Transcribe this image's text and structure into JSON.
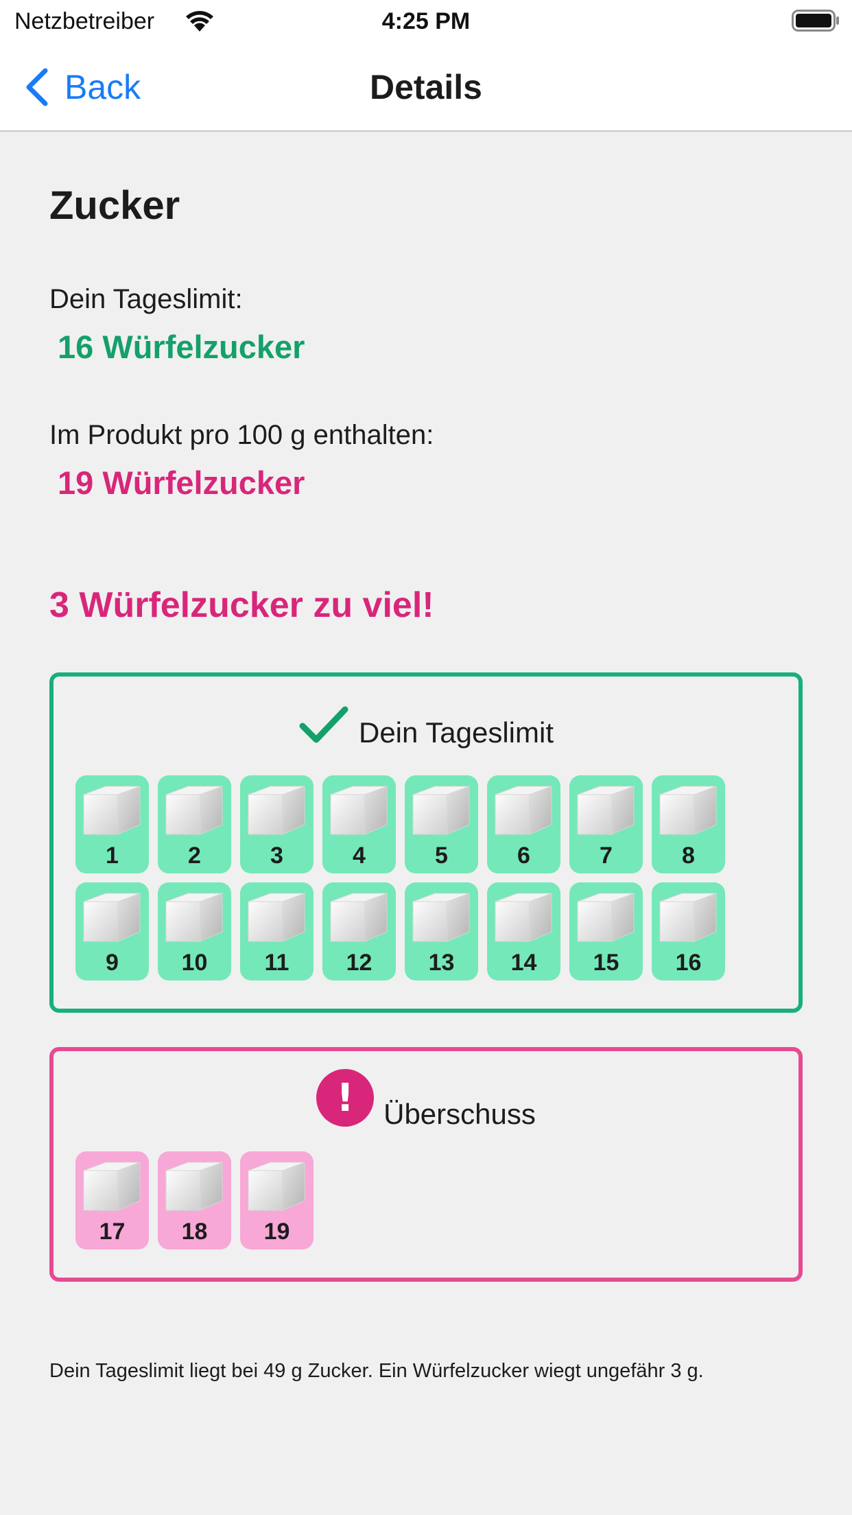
{
  "status_bar": {
    "carrier": "Netzbetreiber",
    "time": "4:25 PM"
  },
  "nav": {
    "back_label": "Back",
    "title": "Details"
  },
  "detail": {
    "title": "Zucker",
    "limit_label": "Dein Tageslimit:",
    "limit_value": "16 Würfelzucker",
    "product_label": "Im Produkt pro 100 g enthalten:",
    "product_value": "19 Würfelzucker",
    "warning": "3 Würfelzucker zu viel!"
  },
  "limit_box": {
    "icon": "checkmark-icon",
    "label": "Dein Tageslimit",
    "cubes": [
      "1",
      "2",
      "3",
      "4",
      "5",
      "6",
      "7",
      "8",
      "9",
      "10",
      "11",
      "12",
      "13",
      "14",
      "15",
      "16"
    ]
  },
  "excess_box": {
    "icon": "exclamation-icon",
    "icon_glyph": "!",
    "label": "Überschuss",
    "cubes": [
      "17",
      "18",
      "19"
    ]
  },
  "footer_note": "Dein Tageslimit liegt bei 49 g Zucker. Ein Würfelzucker wiegt ungefähr 3 g.",
  "colors": {
    "accent_blue": "#1a7cf5",
    "limit_green": "#14a06a",
    "box_green": "#16b07c",
    "cube_green_bg": "#74e8b8",
    "warning_pink": "#d8267a",
    "box_pink": "#e64a92",
    "cube_pink_bg": "#f7a8d6"
  }
}
